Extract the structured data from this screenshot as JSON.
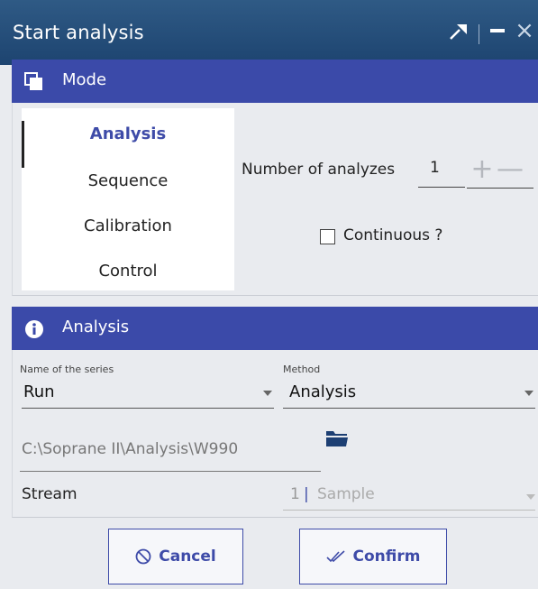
{
  "window": {
    "title": "Start analysis",
    "controls": {
      "pin_icon": "pin-icon",
      "minimize_label": "–",
      "close_label": "×"
    }
  },
  "mode": {
    "header": "Mode",
    "header_icon": "mode-icon",
    "items": [
      {
        "label": "Analysis",
        "active": true
      },
      {
        "label": "Sequence",
        "active": false
      },
      {
        "label": "Calibration",
        "active": false
      },
      {
        "label": "Control",
        "active": false
      }
    ],
    "number_of_analyzes_label": "Number of analyzes",
    "number_of_analyzes_value": "1",
    "plus_label": "+",
    "minus_label": "—",
    "continuous_label": "Continuous ?",
    "continuous_checked": false
  },
  "analysis": {
    "header": "Analysis",
    "header_icon": "info-icon",
    "series_label": "Name of the series",
    "series_value": "Run",
    "method_label": "Method",
    "method_value": "Analysis",
    "path_value": "C:\\Soprane II\\Analysis\\W990",
    "stream_label": "Stream",
    "stream_number": "1",
    "stream_separator": "|",
    "stream_value": "Sample"
  },
  "buttons": {
    "cancel_label": "Cancel",
    "confirm_label": "Confirm"
  },
  "colors": {
    "accent": "#3b4aa9",
    "titlebar": "#1d4470",
    "panel_bg": "#e9ebef"
  }
}
